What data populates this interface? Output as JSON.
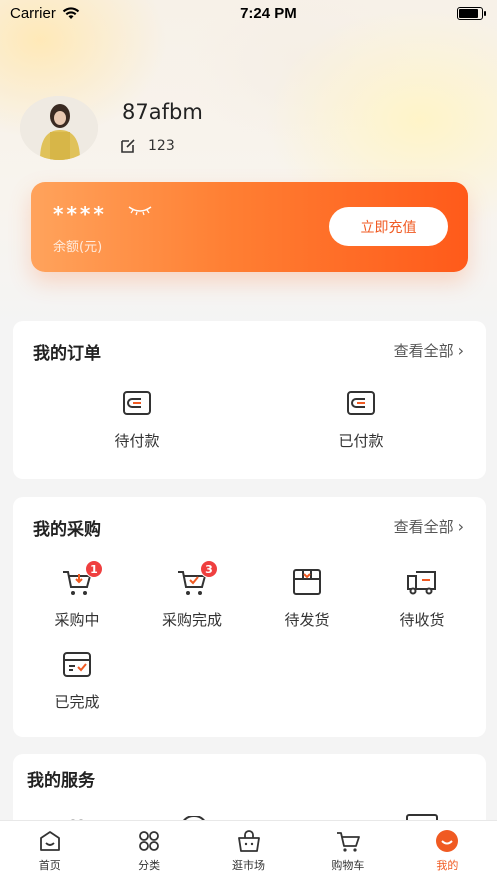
{
  "status_bar": {
    "carrier": "Carrier",
    "time": "7:24 PM"
  },
  "profile": {
    "username": "87afbm",
    "user_id": "123"
  },
  "balance": {
    "masked_value": "****",
    "label": "余额(元)",
    "recharge_label": "立即充值"
  },
  "orders": {
    "title": "我的订单",
    "view_all": "查看全部",
    "items": [
      {
        "label": "待付款",
        "icon": "wallet-icon"
      },
      {
        "label": "已付款",
        "icon": "wallet-icon"
      }
    ]
  },
  "purchases": {
    "title": "我的采购",
    "view_all": "查看全部",
    "items": [
      {
        "label": "采购中",
        "icon": "cart-down-icon",
        "badge": "1"
      },
      {
        "label": "采购完成",
        "icon": "cart-check-icon",
        "badge": "3"
      },
      {
        "label": "待发货",
        "icon": "package-icon"
      },
      {
        "label": "待收货",
        "icon": "truck-icon"
      },
      {
        "label": "已完成",
        "icon": "box-check-icon"
      }
    ]
  },
  "services": {
    "title": "我的服务"
  },
  "tabs": [
    {
      "label": "首页",
      "icon": "home-icon",
      "active": false
    },
    {
      "label": "分类",
      "icon": "category-icon",
      "active": false
    },
    {
      "label": "逛市场",
      "icon": "market-icon",
      "active": false
    },
    {
      "label": "购物车",
      "icon": "cart-icon",
      "active": false
    },
    {
      "label": "我的",
      "icon": "profile-icon",
      "active": true
    }
  ],
  "colors": {
    "accent": "#f05a22",
    "badge": "#ef3f3f"
  }
}
